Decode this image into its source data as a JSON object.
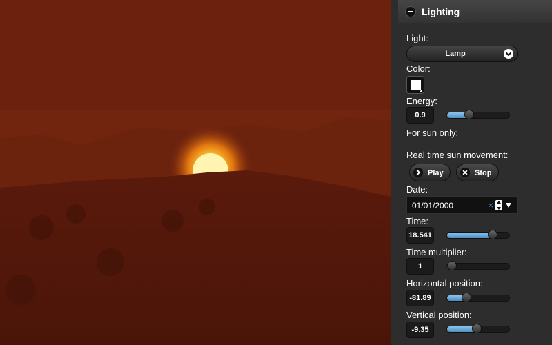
{
  "panel": {
    "title": "Lighting",
    "light_label": "Light:",
    "light_value": "Lamp",
    "color_label": "Color:",
    "color_value": "#ffffff",
    "energy_label": "Energy:",
    "energy_value": "0.9",
    "energy_level": 0.33,
    "sun_only_label": "For sun only:",
    "realtime_label": "Real time sun movement:",
    "play_label": "Play",
    "stop_label": "Stop",
    "date_label": "Date:",
    "date_value": "01/01/2000",
    "clear_symbol": "×",
    "time_label": "Time:",
    "time_value": "18.541",
    "time_level": 0.77,
    "multiplier_label": "Time multiplier:",
    "multiplier_value": "1",
    "multiplier_level": 0.0,
    "horizontal_label": "Horizontal position:",
    "horizontal_value": "-81.89",
    "horizontal_level": 0.27,
    "vertical_label": "Vertical position:",
    "vertical_value": "-9.35",
    "vertical_level": 0.48
  },
  "icons": {
    "collapse": "minus-circle-icon",
    "dropdown": "chevron-down-icon",
    "play": "chevron-right-icon",
    "stop": "close-icon",
    "spin": "spinner-icon",
    "calendar": "triangle-down-icon"
  },
  "colors": {
    "accent": "#5a9fd4",
    "panel_bg": "#2d2d2d",
    "sky": "#6a200d",
    "sun": "#fff0a0"
  }
}
